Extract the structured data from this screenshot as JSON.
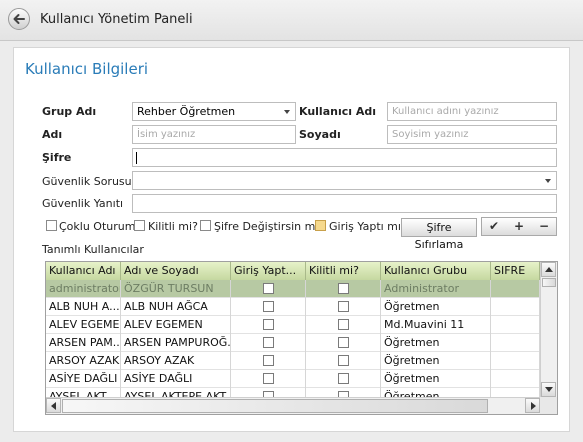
{
  "window": {
    "title": "Kullanıcı Yönetim Paneli"
  },
  "section_title": "Kullanıcı Bilgileri",
  "form": {
    "grup_adi_label": "Grup Adı",
    "grup_adi_value": "Rehber Öğretmen",
    "kullanici_adi_label": "Kullanıcı Adı",
    "kullanici_adi_placeholder": "Kullanıcı adını yazınız",
    "adi_label": "Adı",
    "adi_placeholder": "İsim yazınız",
    "soyadi_label": "Soyadı",
    "soyadi_placeholder": "Soyisim yazınız",
    "sifre_label": "Şifre",
    "guvenlik_sorusu_label": "Güvenlik Sorusu",
    "guvenlik_yaniti_label": "Güvenlik Yanıtı"
  },
  "filters": {
    "coklu_oturum": "Çoklu Oturum",
    "kilitli_mi": "Kilitli mi?",
    "sifre_degistirsin_mi": "Şifre Değiştirsin mi?",
    "giris_yapti_mi": "Giriş Yaptı mı?",
    "sifre_sifirlama_button": "Şifre Sıfırlama",
    "check_glyph": "✔",
    "plus_glyph": "+",
    "minus_glyph": "−"
  },
  "grid": {
    "title": "Tanımlı Kullanıcılar",
    "columns": [
      "Kullanıcı Adı",
      "Adı ve Soyadı",
      "Giriş Yapt...",
      "Kilitli mi?",
      "Kullanıcı Grubu",
      "SIFRE"
    ],
    "rows": [
      {
        "kullanici_adi": "administrator",
        "ad_soyad": "ÖZGÜR TURSUN",
        "giris": false,
        "kilitli": false,
        "grup": "Administrator",
        "sifre": "",
        "selected": true
      },
      {
        "kullanici_adi": "ALB NUH A...",
        "ad_soyad": "ALB NUH AĞCA",
        "giris": false,
        "kilitli": false,
        "grup": "Öğretmen",
        "sifre": "",
        "selected": false
      },
      {
        "kullanici_adi": "ALEV EGEMEN",
        "ad_soyad": "ALEV EGEMEN",
        "giris": false,
        "kilitli": false,
        "grup": "Md.Muavini 11",
        "sifre": "",
        "selected": false
      },
      {
        "kullanici_adi": "ARSEN PAM...",
        "ad_soyad": "ARSEN PAMPUROĞ...",
        "giris": false,
        "kilitli": false,
        "grup": "Öğretmen",
        "sifre": "",
        "selected": false
      },
      {
        "kullanici_adi": "ARSOY AZAK",
        "ad_soyad": "ARSOY AZAK",
        "giris": false,
        "kilitli": false,
        "grup": "Öğretmen",
        "sifre": "",
        "selected": false
      },
      {
        "kullanici_adi": "ASİYE DAĞLI",
        "ad_soyad": "ASİYE DAĞLI",
        "giris": false,
        "kilitli": false,
        "grup": "Öğretmen",
        "sifre": "",
        "selected": false
      },
      {
        "kullanici_adi": "AYSEL AKT...",
        "ad_soyad": "AYSEL AKTEPE AKT...",
        "giris": false,
        "kilitli": false,
        "grup": "Öğretmen",
        "sifre": "",
        "selected": false
      }
    ]
  },
  "colors": {
    "accent": "#2a7cb8",
    "grid_header": "#d5e4b4",
    "selected_row": "#b7c9a3"
  },
  "icons": {
    "back": "arrow-left-icon",
    "dropdown": "chevron-down-icon"
  }
}
